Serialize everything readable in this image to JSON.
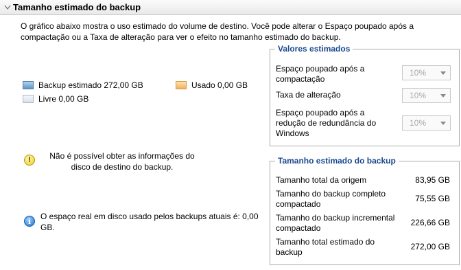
{
  "section": {
    "title": "Tamanho estimado do backup"
  },
  "description": "O gráfico abaixo mostra o uso estimado do volume de destino. Você pode alterar o Espaço poupado após a compactação ou a Taxa de alteração para ver o efeito no tamanho estimado do backup.",
  "legend": {
    "backup": "Backup estimado 272,00 GB",
    "used": "Usado 0,00 GB",
    "free": "Livre 0,00 GB"
  },
  "estimated_values": {
    "title": "Valores estimados",
    "rows": [
      {
        "label": "Espaço poupado após a compactação",
        "value": "10%"
      },
      {
        "label": "Taxa de alteração",
        "value": "10%"
      },
      {
        "label": "Espaço poupado após a redução de redundância do Windows",
        "value": "10%"
      }
    ]
  },
  "messages": {
    "warning": "Não é possível obter as informações do disco de destino do backup.",
    "info": "O espaço real em disco usado pelos backups atuais é: 0,00 GB."
  },
  "estimated_size": {
    "title": "Tamanho estimado do backup",
    "rows": [
      {
        "label": "Tamanho total da origem",
        "value": "83,95 GB"
      },
      {
        "label": "Tamanho do backup completo compactado",
        "value": "75,55 GB"
      },
      {
        "label": "Tamanho do backup incremental compactado",
        "value": "226,66 GB"
      },
      {
        "label": "Tamanho total estimado do backup",
        "value": "272,00 GB"
      }
    ]
  },
  "colors": {
    "accent": "#1b4a8d",
    "backup": "#5f95c6",
    "used": "#f2b25b",
    "free": "#d7e1ea"
  }
}
